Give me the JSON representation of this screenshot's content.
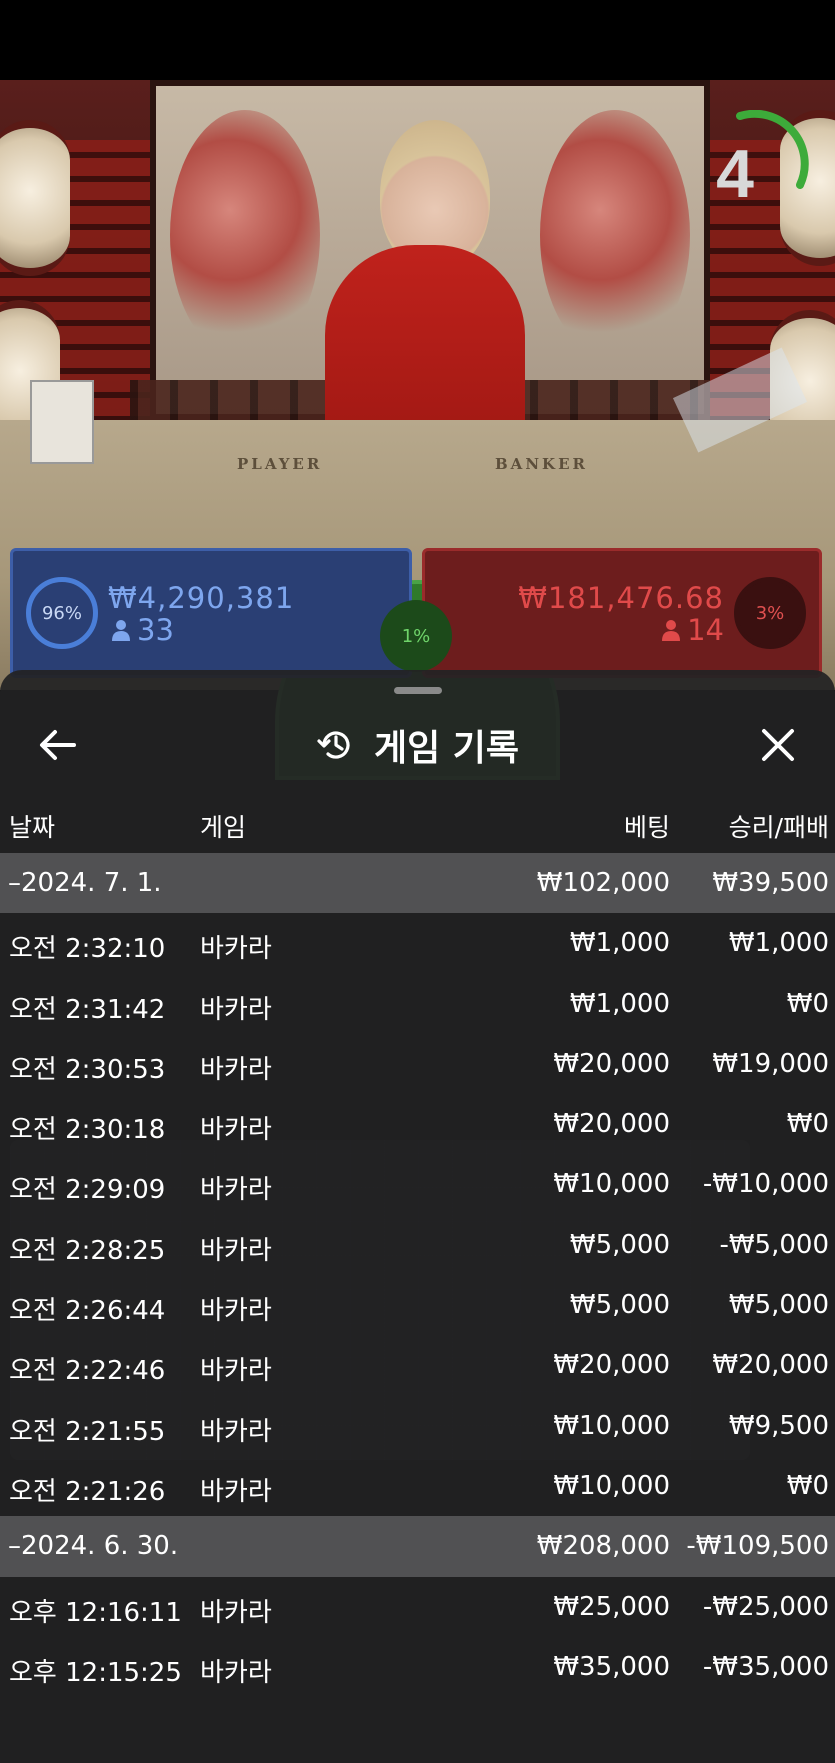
{
  "video": {
    "countdown": "4",
    "table_labels": {
      "player": "PLAYER",
      "banker": "BANKER"
    }
  },
  "stats": {
    "player": {
      "percent": "96%",
      "amount": "₩4,290,381",
      "count": "33"
    },
    "tie": {
      "percent": "1%"
    },
    "banker": {
      "percent": "3%",
      "amount": "₩181,476.68",
      "count": "14"
    }
  },
  "sheet": {
    "title": "게임 기록",
    "columns": {
      "date": "날짜",
      "game": "게임",
      "bet": "베팅",
      "result": "승리/패배"
    }
  },
  "rows": [
    {
      "type": "group",
      "date": "–2024. 7. 1.",
      "game": "",
      "bet": "₩102,000",
      "result": "₩39,500"
    },
    {
      "type": "item",
      "date": "오전 2:32:10",
      "game": "바카라",
      "bet": "₩1,000",
      "result": "₩1,000"
    },
    {
      "type": "item",
      "date": "오전 2:31:42",
      "game": "바카라",
      "bet": "₩1,000",
      "result": "₩0"
    },
    {
      "type": "item",
      "date": "오전 2:30:53",
      "game": "바카라",
      "bet": "₩20,000",
      "result": "₩19,000"
    },
    {
      "type": "item",
      "date": "오전 2:30:18",
      "game": "바카라",
      "bet": "₩20,000",
      "result": "₩0"
    },
    {
      "type": "item",
      "date": "오전 2:29:09",
      "game": "바카라",
      "bet": "₩10,000",
      "result": "-₩10,000"
    },
    {
      "type": "item",
      "date": "오전 2:28:25",
      "game": "바카라",
      "bet": "₩5,000",
      "result": "-₩5,000"
    },
    {
      "type": "item",
      "date": "오전 2:26:44",
      "game": "바카라",
      "bet": "₩5,000",
      "result": "₩5,000"
    },
    {
      "type": "item",
      "date": "오전 2:22:46",
      "game": "바카라",
      "bet": "₩20,000",
      "result": "₩20,000"
    },
    {
      "type": "item",
      "date": "오전 2:21:55",
      "game": "바카라",
      "bet": "₩10,000",
      "result": "₩9,500"
    },
    {
      "type": "item",
      "date": "오전 2:21:26",
      "game": "바카라",
      "bet": "₩10,000",
      "result": "₩0"
    },
    {
      "type": "group",
      "date": "–2024. 6. 30.",
      "game": "",
      "bet": "₩208,000",
      "result": "-₩109,500"
    },
    {
      "type": "item",
      "date": "오후 12:16:11",
      "game": "바카라",
      "bet": "₩25,000",
      "result": "-₩25,000"
    },
    {
      "type": "item",
      "date": "오후 12:15:25",
      "game": "바카라",
      "bet": "₩35,000",
      "result": "-₩35,000"
    }
  ],
  "colors": {
    "sheet_bg": "#222224",
    "group_row_bg": "#5a5a5c",
    "player_blue": "#2a3f74",
    "banker_red": "#6d1d1d",
    "tie_green": "#2f7a2b"
  },
  "icons": {
    "back": "arrow-left-icon",
    "history": "history-icon",
    "close": "close-icon"
  }
}
